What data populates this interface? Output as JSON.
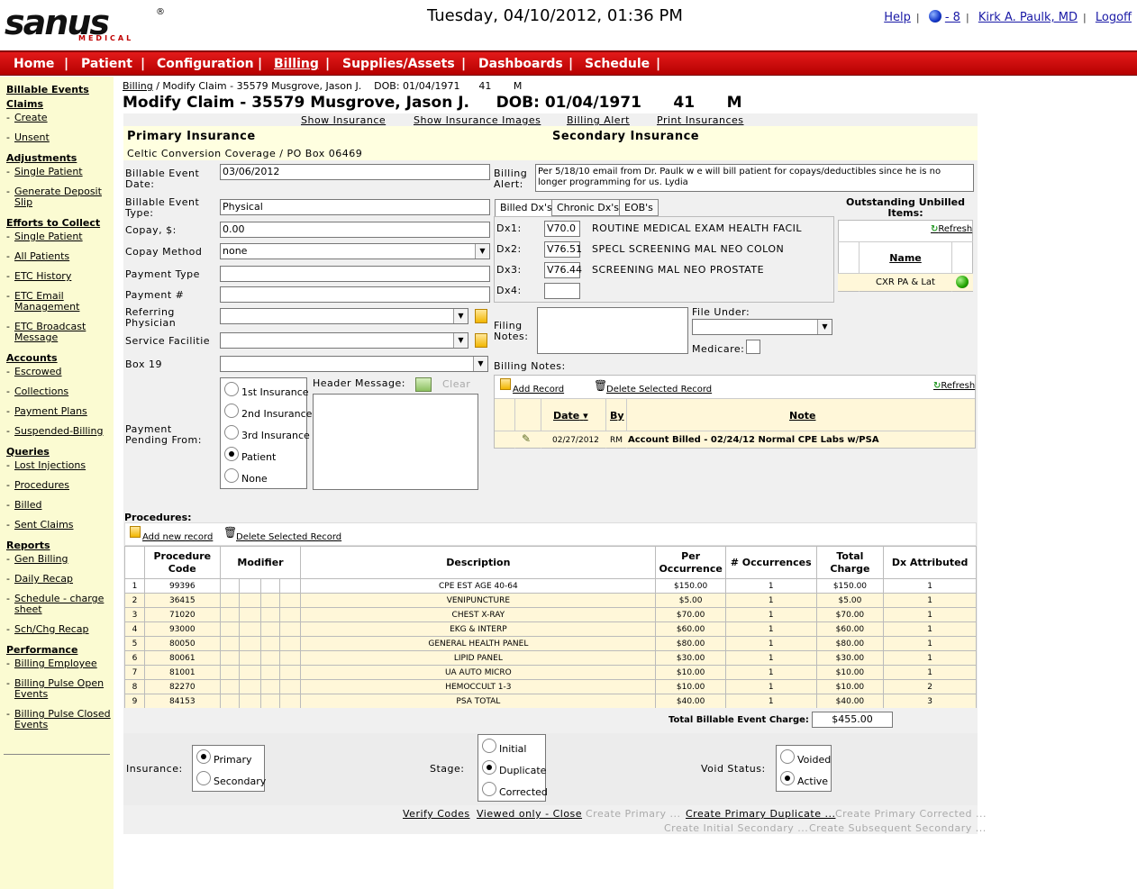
{
  "header": {
    "logo": "sanus",
    "logo_sub": "MEDICAL",
    "logo_reg": "®",
    "datetime": "Tuesday, 04/10/2012, 01:36 PM",
    "help": "Help",
    "messages": "- 8",
    "user": "Kirk A. Paulk, MD",
    "logoff": "Logoff"
  },
  "nav": [
    "Home",
    "Patient",
    "Configuration",
    "Billing",
    "Supplies/Assets",
    "Dashboards",
    "Schedule"
  ],
  "sidebar": {
    "billable_events": "Billable Events",
    "claims": "Claims",
    "create": "Create",
    "unsent": "Unsent",
    "adjustments": "Adjustments",
    "single_patient": "Single Patient",
    "gen_deposit": "Generate Deposit Slip",
    "efforts": "Efforts to Collect",
    "etc_single": "Single Patient",
    "all_patients": "All Patients",
    "etc_history": "ETC History",
    "etc_email": "ETC Email Management",
    "etc_broadcast": "ETC Broadcast Message",
    "accounts": "Accounts",
    "escrowed": "Escrowed",
    "collections": "Collections",
    "payment_plans": "Payment Plans",
    "suspended": "Suspended-Billing",
    "queries": "Queries",
    "lost_inj": "Lost Injections",
    "procedures": "Procedures",
    "billed": "Billed",
    "sent_claims": "Sent Claims",
    "reports": "Reports",
    "gen_billing": "Gen Billing",
    "daily_recap": "Daily Recap",
    "sched_charge": "Schedule - charge sheet",
    "sch_chg": "Sch/Chg Recap",
    "performance": "Performance",
    "billing_emp": "Billing Employee",
    "pulse_open": "Billing Pulse Open Events",
    "pulse_closed": "Billing Pulse Closed Events"
  },
  "crumb": {
    "billing": "Billing",
    "rest": " / Modify Claim - 35579 Musgrove, Jason J.    DOB: 01/04/1971      41       M"
  },
  "title": "Modify Claim - 35579 Musgrove, Jason J.     DOB: 01/04/1971      41      M",
  "ins_links": {
    "show_ins": "Show Insurance",
    "show_imgs": "Show Insurance Images",
    "alert": "Billing Alert",
    "print": "Print Insurances"
  },
  "primary": {
    "label": "Primary Insurance",
    "name": "Celtic Conversion Coverage / PO Box 06469"
  },
  "secondary": {
    "label": "Secondary Insurance"
  },
  "form": {
    "event_date_label": "Billable Event Date:",
    "event_date": "03/06/2012",
    "event_type_label": "Billable Event Type:",
    "event_type": "Physical",
    "copay_label": "Copay, $:",
    "copay": "0.00",
    "copay_method_label": "Copay Method",
    "copay_method": "none",
    "payment_type_label": "Payment Type",
    "payment_no_label": "Payment #",
    "ref_phys_label": "Referring Physician",
    "service_fac_label": "Service Facilitie",
    "box19_label": "Box 19",
    "pending_label": "Payment Pending From:",
    "pending_opts": [
      "1st Insurance",
      "2nd Insurance",
      "3rd Insurance",
      "Patient",
      "None"
    ],
    "header_msg_label": "Header Message:",
    "clear": "Clear"
  },
  "alert": {
    "label": "Billing Alert:",
    "text": "Per 5/18/10 email from Dr. Paulk w e will bill patient for copays/deductibles since he is no longer programming for us.  Lydia"
  },
  "dx_tabs": [
    "Billed Dx's",
    "Chronic Dx's",
    "EOB's"
  ],
  "dx": [
    {
      "label": "Dx1:",
      "code": "V70.0",
      "desc": "ROUTINE MEDICAL EXAM HEALTH FACIL"
    },
    {
      "label": "Dx2:",
      "code": "V76.51",
      "desc": "SPECL SCREENING MAL NEO COLON"
    },
    {
      "label": "Dx3:",
      "code": "V76.44",
      "desc": "SCREENING MAL NEO PROSTATE"
    },
    {
      "label": "Dx4:",
      "code": "",
      "desc": ""
    }
  ],
  "unbilled": {
    "title": "Outstanding Unbilled Items:",
    "refresh": "Refresh",
    "col": "Name",
    "item": "CXR PA & Lat"
  },
  "filing": {
    "notes_label": "Filing Notes:",
    "file_under": "File Under:",
    "medicare": "Medicare:",
    "billing_notes": "Billing Notes:"
  },
  "notes": {
    "add": "Add Record",
    "delete": "Delete Selected Record",
    "refresh": "Refresh",
    "cols": [
      "Date",
      "By",
      "Note"
    ],
    "row": {
      "date": "02/27/2012",
      "by": "RM",
      "note": "Account Billed - 02/24/12 Normal CPE Labs w/PSA"
    }
  },
  "procedures": {
    "label": "Procedures:",
    "add": "Add new record",
    "delete": "Delete Selected Record",
    "cols": [
      "Procedure Code",
      "Modifier",
      "Description",
      "Per Occurrence",
      "# Occurrences",
      "Total Charge",
      "Dx Attributed"
    ],
    "rows": [
      [
        "1",
        "99396",
        "CPE EST AGE 40-64",
        "$150.00",
        "1",
        "$150.00",
        "1"
      ],
      [
        "2",
        "36415",
        "VENIPUNCTURE",
        "$5.00",
        "1",
        "$5.00",
        "1"
      ],
      [
        "3",
        "71020",
        "CHEST X-RAY",
        "$70.00",
        "1",
        "$70.00",
        "1"
      ],
      [
        "4",
        "93000",
        "EKG & INTERP",
        "$60.00",
        "1",
        "$60.00",
        "1"
      ],
      [
        "5",
        "80050",
        "GENERAL HEALTH PANEL",
        "$80.00",
        "1",
        "$80.00",
        "1"
      ],
      [
        "6",
        "80061",
        "LIPID PANEL",
        "$30.00",
        "1",
        "$30.00",
        "1"
      ],
      [
        "7",
        "81001",
        "UA AUTO MICRO",
        "$10.00",
        "1",
        "$10.00",
        "1"
      ],
      [
        "8",
        "82270",
        "HEMOCCULT 1-3",
        "$10.00",
        "1",
        "$10.00",
        "2"
      ],
      [
        "9",
        "84153",
        "PSA TOTAL",
        "$40.00",
        "1",
        "$40.00",
        "3"
      ]
    ],
    "total_label": "Total Billable Event Charge:",
    "total": "$455.00"
  },
  "bottom": {
    "insurance": "Insurance:",
    "ins_opts": [
      "Primary",
      "Secondary"
    ],
    "stage": "Stage:",
    "stage_opts": [
      "Initial",
      "Duplicate",
      "Corrected"
    ],
    "void": "Void Status:",
    "void_opts": [
      "Voided",
      "Active"
    ]
  },
  "actions": {
    "verify": "Verify Codes",
    "viewed": "Viewed only - Close",
    "cp": "Create Primary ...",
    "cpd": "Create Primary Duplicate ...",
    "cpc": "Create Primary Corrected ...",
    "cis": "Create Initial Secondary ...",
    "css": "Create Subsequent Secondary ..."
  }
}
